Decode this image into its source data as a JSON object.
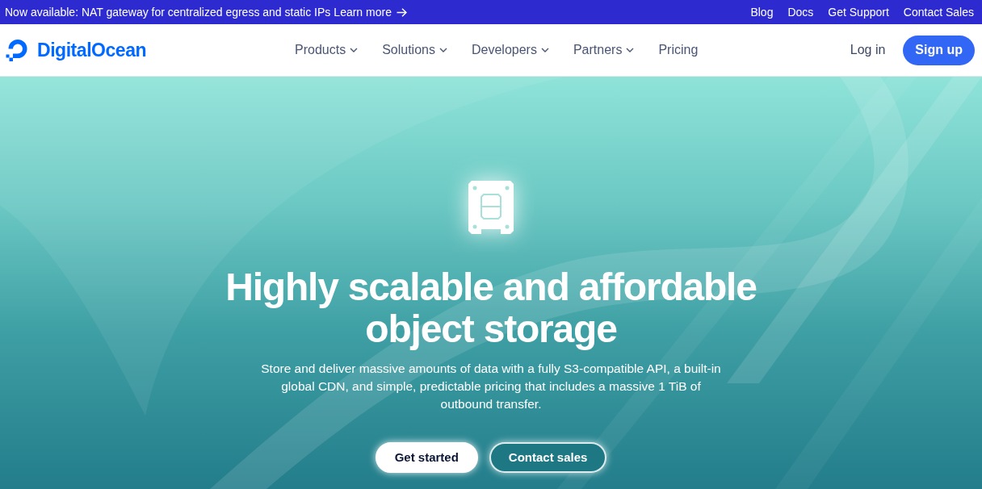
{
  "announcement": {
    "text": "Now available: NAT gateway for centralized egress and static IPs",
    "link": "Learn more"
  },
  "top_links": [
    "Blog",
    "Docs",
    "Get Support",
    "Contact Sales"
  ],
  "header": {
    "brand": "DigitalOcean",
    "nav": [
      {
        "label": "Products",
        "kind": "dropdown"
      },
      {
        "label": "Solutions",
        "kind": "dropdown"
      },
      {
        "label": "Developers",
        "kind": "dropdown"
      },
      {
        "label": "Partners",
        "kind": "dropdown"
      },
      {
        "label": "Pricing",
        "kind": "link"
      }
    ],
    "login": "Log in",
    "signup": "Sign up"
  },
  "hero": {
    "heading": "Highly scalable and affordable object storage",
    "description": "Store and deliver massive amounts of data with a fully S3-compatible API, a built-in global CDN, and simple, predictable pricing that includes a massive 1 TiB of outbound transfer.",
    "buttons": [
      {
        "label": "Get started",
        "kind": "primary"
      },
      {
        "label": "Contact sales",
        "kind": "secondary"
      }
    ]
  }
}
